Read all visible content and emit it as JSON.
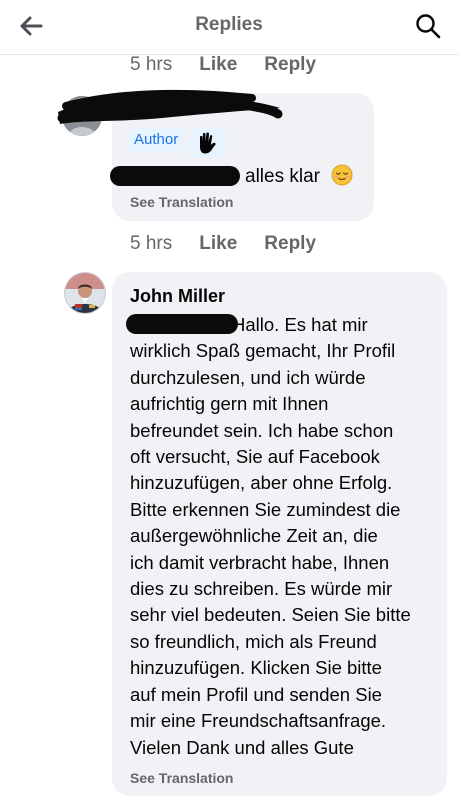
{
  "header": {
    "title": "Replies",
    "back_icon": "arrow-left-icon",
    "search_icon": "search-icon"
  },
  "thread": {
    "top_actions": {
      "time": "5 hrs",
      "like": "Like",
      "reply": "Reply"
    },
    "comment_1": {
      "badge": "Author",
      "badge_icon": "waving-hand-icon",
      "text": "alles klar",
      "emoji": "relieved-face-icon",
      "see_translation": "See Translation",
      "actions": {
        "time": "5 hrs",
        "like": "Like",
        "reply": "Reply"
      }
    },
    "comment_2": {
      "author": "John Miller",
      "lines": [
        "Hallo. Es hat mir",
        "wirklich Spaß gemacht, Ihr Profil",
        "durchzulesen, und ich würde",
        "aufrichtig gern mit Ihnen",
        "befreundet sein. Ich habe schon",
        "oft versucht, Sie auf Facebook",
        "hinzuzufügen, aber ohne Erfolg.",
        "Bitte erkennen Sie zumindest die",
        "außergewöhnliche Zeit an, die",
        "ich damit verbracht habe, Ihnen",
        "dies zu schreiben. Es würde mir",
        "sehr viel bedeuten. Seien Sie bitte",
        "so freundlich, mich als Freund",
        "hinzuzufügen. Klicken Sie bitte",
        "auf mein Profil und senden Sie",
        "mir eine Freundschaftsanfrage.",
        "Vielen Dank und alles Gute"
      ],
      "see_translation": "See Translation"
    }
  },
  "colors": {
    "bubble": "#f0f2f5",
    "secondary_text": "#65676b",
    "author_badge_bg": "#e7f3ff",
    "author_badge_text": "#1b74e4",
    "redaction": "#0b0b0b"
  }
}
